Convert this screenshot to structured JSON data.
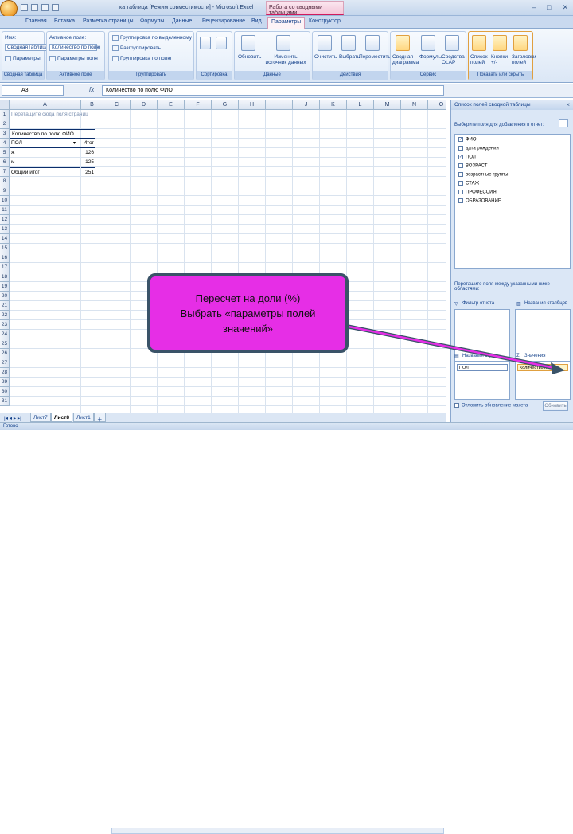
{
  "window": {
    "title": "ка таблица [Режим совместимости] - Microsoft Excel",
    "context_tab_group": "Работа со сводными таблицами"
  },
  "ribbon_tabs": [
    "Главная",
    "Вставка",
    "Разметка страницы",
    "Формулы",
    "Данные",
    "Рецензирование",
    "Вид",
    "Параметры",
    "Конструктор"
  ],
  "active_tab": "Параметры",
  "ribbon": {
    "pivot_group": {
      "name_label": "Имя:",
      "name_value": "СводнаяТаблица1",
      "params": "Параметры",
      "label": "Сводная таблица"
    },
    "active_field": {
      "label_top": "Активное поле:",
      "value": "Количество по полю",
      "params": "Параметры поля",
      "label": "Активное поле"
    },
    "grouping": {
      "items": [
        "Группировка по выделенному",
        "Разгруппировать",
        "Группировка по полю"
      ],
      "label": "Группировать"
    },
    "sort": {
      "label": "Сортировка"
    },
    "data": {
      "items": [
        "Обновить",
        "Изменить источник данных"
      ],
      "label": "Данные"
    },
    "actions": {
      "items": [
        "Очистить",
        "Выбрать",
        "Переместить"
      ],
      "label": "Действия"
    },
    "tools": {
      "items": [
        "Сводная диаграмма",
        "Формулы",
        "Средства OLAP"
      ],
      "label": "Сервис"
    },
    "show": {
      "items": [
        "Список полей",
        "Кнопки +/-",
        "Заголовки полей"
      ],
      "label": "Показать или скрыть"
    }
  },
  "formula_bar": {
    "cell_ref": "A3",
    "fx": "fx",
    "value": "Количество по полю ФИО"
  },
  "sheet": {
    "columns": [
      "A",
      "B",
      "C",
      "D",
      "E",
      "F",
      "G",
      "H",
      "I",
      "J",
      "K",
      "L",
      "M",
      "N",
      "O"
    ],
    "rows": [
      "1",
      "2",
      "3",
      "4",
      "5",
      "6",
      "7",
      "8",
      "9",
      "10",
      "11",
      "12",
      "13",
      "14",
      "15",
      "16",
      "17",
      "18",
      "19",
      "20",
      "21",
      "22",
      "23",
      "24",
      "25",
      "26",
      "27",
      "28",
      "29",
      "30",
      "31"
    ],
    "cells": {
      "a1": "Перетащите сюда поля страниц",
      "a3": "Количество по полю ФИО",
      "a4": "ПОЛ",
      "b4": "Итог",
      "a5": "ж",
      "b5": "126",
      "a6": "м",
      "b6": "125",
      "a7": "Общий итог",
      "b7": "251"
    },
    "tabs": [
      "Лист7",
      "Лист8",
      "Лист1"
    ],
    "active_sheet": "Лист8"
  },
  "status_bar": {
    "text": "Готово"
  },
  "field_list": {
    "title": "Список полей сводной таблицы",
    "subtitle": "Выберите поля для добавления в отчет:",
    "fields": [
      {
        "label": "ФИО",
        "checked": true
      },
      {
        "label": "дата рождения",
        "checked": false
      },
      {
        "label": "ПОЛ",
        "checked": true
      },
      {
        "label": "ВОЗРАСТ",
        "checked": false
      },
      {
        "label": "возрастные группы",
        "checked": false
      },
      {
        "label": "СТАЖ",
        "checked": false
      },
      {
        "label": "ПРОФЕССИЯ",
        "checked": false
      },
      {
        "label": "ОБРАЗОВАНИЕ",
        "checked": false
      }
    ],
    "areas_caption": "Перетащите поля между указанными ниже областями:",
    "report_filter": "Фильтр отчета",
    "column_labels": "Названия столбцов",
    "row_labels": "Названия строк",
    "values": "Значения",
    "row_item": "ПОЛ",
    "value_item": "Количество по п...",
    "defer_label": "Отложить обновление макета",
    "update_btn": "Обновить"
  },
  "callout": {
    "line1": "Пересчет на доли (%)",
    "line2": "Выбрать «параметры полей",
    "line3": "значений»"
  }
}
